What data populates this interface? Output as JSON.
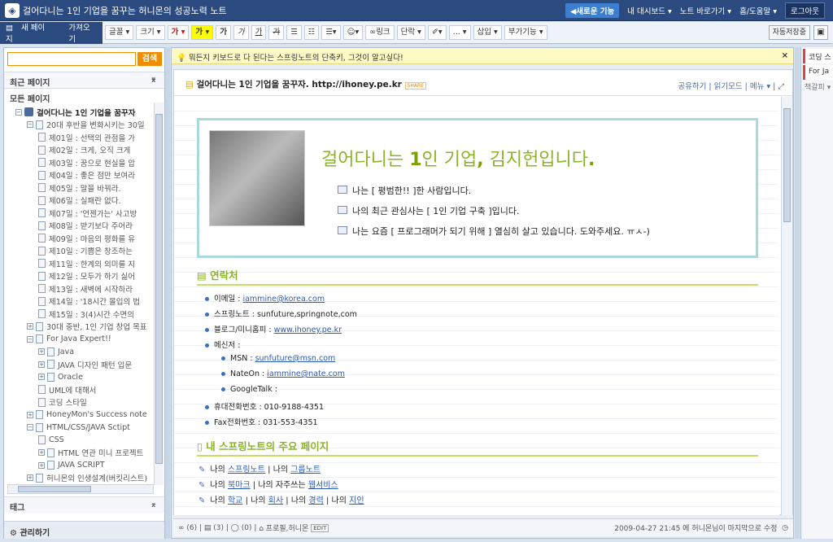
{
  "topbar": {
    "title": "걸어다니는 1인 기업을 꿈꾸는 허니몬의 성공노력 노트",
    "new_feature": "◀새로운 기능",
    "dashboard": "내 대시보드",
    "note_shortcut": "노트 바로가기",
    "home_help": "홈/도움말",
    "logout": "로그아웃"
  },
  "toolbar": {
    "new_page": "새 페이지",
    "import": "가져오기",
    "font": "글꼴",
    "size": "크기",
    "color1": "가",
    "color2": "가",
    "bold": "가",
    "italic": "가",
    "underline": "가",
    "strike": "가",
    "link": "링크",
    "paragraph": "단락",
    "more": "...",
    "insert": "삽입",
    "addons": "부가기능",
    "autosave": "자동저장중"
  },
  "sidebar": {
    "search_button": "검색",
    "search_value": "",
    "recent": "최근 페이지",
    "all": "모든 페이지",
    "tags": "태그",
    "manage": "관리하기",
    "tree": [
      {
        "label": "걸어다니는 1인 기업을 꿈꾸자",
        "level": 0,
        "bold": true
      },
      {
        "label": "20대 후반을 변화시키는 30일",
        "level": 1
      },
      {
        "label": "제01일 : 선택의 관점을 가",
        "level": 2
      },
      {
        "label": "제02일 : 크게, 오직 크게",
        "level": 2
      },
      {
        "label": "제03일 : 꿈으로 현실을 압",
        "level": 2
      },
      {
        "label": "제04일 : 좋은 점만 보여라",
        "level": 2
      },
      {
        "label": "제05일 : 말을 바꿔라.",
        "level": 2
      },
      {
        "label": "제06일 : 실패란 없다.",
        "level": 2
      },
      {
        "label": "제07일 : '언젠가는' 사고방",
        "level": 2
      },
      {
        "label": "제08일 : 받기보다 주어라",
        "level": 2
      },
      {
        "label": "제09일 : 마음의 평화를 유",
        "level": 2
      },
      {
        "label": "제10일 : 기쁨은 창조하는",
        "level": 2
      },
      {
        "label": "제11일 : 한계의 의미를 지",
        "level": 2
      },
      {
        "label": "제12일 : 모두가 하기 싫어",
        "level": 2
      },
      {
        "label": "제13일 : 새벽에 시작하라",
        "level": 2
      },
      {
        "label": "제14일 : '18시간 몰입의 법",
        "level": 2
      },
      {
        "label": "제15일 : 3(4)시간 수면의",
        "level": 2
      },
      {
        "label": "30대 중반, 1인 기업 창업 목표",
        "level": 1
      },
      {
        "label": "For Java Expert!!",
        "level": 1
      },
      {
        "label": "Java",
        "level": 2
      },
      {
        "label": "JAVA 디자인 패턴 입문",
        "level": 2
      },
      {
        "label": "Oracle",
        "level": 2
      },
      {
        "label": "UML에 대해서",
        "level": 2
      },
      {
        "label": "코딩 스타일",
        "level": 2
      },
      {
        "label": "HoneyMon's Success note",
        "level": 1
      },
      {
        "label": "HTML/CSS/JAVA Sctipt",
        "level": 1
      },
      {
        "label": "CSS",
        "level": 2
      },
      {
        "label": "HTML 연관 미니 프로젝트",
        "level": 2
      },
      {
        "label": "JAVA SCRIPT",
        "level": 2
      },
      {
        "label": "허니몬의 인생설계(버킷리스트)",
        "level": 1
      }
    ]
  },
  "notice": {
    "text": "뭐든지 키보드로 다 된다는 스프링노트의 단축키, 그것이 알고싶다!",
    "close": "×"
  },
  "document": {
    "title": "걸어다니는 1인 기업을 꿈꾸자. http://ihoney.pe.kr",
    "badge": "SHARE",
    "share": "공유하기",
    "read_mode": "읽기모드",
    "menu": "메뉴",
    "headline_pre": "걸어다니는 ",
    "headline_num": "1",
    "headline_mid": "인 기업",
    "headline_comma": ",",
    "headline_post": " 김지헌입니다",
    "headline_dot": ".",
    "profile_lines": [
      "나는 [ 평범한!! ]한 사람입니다.",
      "나의 최근 관심사는 [ 1인 기업 구축 ]입니다.",
      "나는 요즘 [ 프로그래머가 되기 위해 ] 열심히 살고 있습니다. 도와주세요. ㅠㅅ-)"
    ],
    "contact_heading": "연락처",
    "email_label": "이메일 : ",
    "email": "iammine@korea.com",
    "springnote": "스프링노트 : sunfuture,springnote,com",
    "blog_label": "블로그/미니홈피 : ",
    "blog": "www.ihoney.pe.kr",
    "messenger": "메신저 :",
    "msn_label": "MSN : ",
    "msn": "sunfuture@msn.com",
    "nateon_label": "NateOn : ",
    "nateon": "iammine@nate.com",
    "gtalk": "GoogleTalk :",
    "mobile": "휴대전화번호 : 010-9188-4351",
    "fax": "Fax전화번호 : 031-553-4351",
    "pages_heading": "내 스프링노트의 주요 페이지",
    "rows": [
      [
        "나의 ",
        "스프링노트",
        " | 나의 ",
        "그룹노트",
        "",
        ""
      ],
      [
        "나의 ",
        "북마크",
        " | 나의 자주쓰는 ",
        "웹서비스",
        "",
        ""
      ],
      [
        "나의 ",
        "학교",
        " | 나의 ",
        "회사",
        " | 나의 ",
        "경력"
      ]
    ],
    "row3_tail_sep": " | 나의 ",
    "row3_tail": "지인"
  },
  "statusbar": {
    "links": "(6)",
    "pages": "(3)",
    "comments": "(0)",
    "tags": "프로필,허니몬",
    "edit": "EDIT",
    "last_modified": "2009-04-27 21:45 에 허니몬님이 마지막으로 수정"
  },
  "rightpanel": {
    "tab1": "코딩 스",
    "tab2": "For Ja",
    "tab3": "책갈피"
  }
}
